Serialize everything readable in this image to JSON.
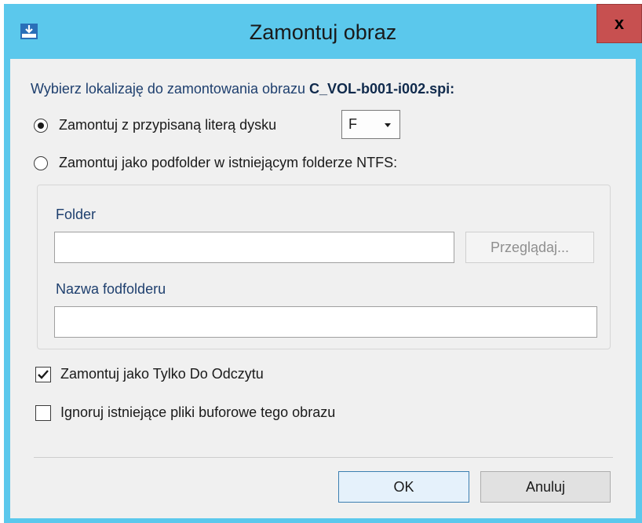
{
  "window": {
    "title": "Zamontuj obraz",
    "close_label": "x"
  },
  "dialog": {
    "prompt_text": "Wybierz lokalizaję do zamontowania obrazu ",
    "prompt_filename": "C_VOL-b001-i002.spi:",
    "option_drive_letter": {
      "label": "Zamontuj z przypisaną literą dysku",
      "selected": true,
      "drive_letter": "F"
    },
    "option_subfolder": {
      "label": "Zamontuj jako podfolder w istniejącym folderze NTFS:",
      "selected": false
    },
    "folder_label": "Folder",
    "folder_value": "",
    "browse_label": "Przeglądaj...",
    "subfolder_label": "Nazwa fodfolderu",
    "subfolder_value": "",
    "readonly_checkbox": {
      "label": "Zamontuj jako Tylko Do Odczytu",
      "checked": true
    },
    "ignore_checkbox": {
      "label": "Ignoruj istniejące pliki buforowe tego obrazu",
      "checked": false
    },
    "ok_label": "OK",
    "cancel_label": "Anuluj"
  },
  "colors": {
    "titlebar": "#5bc8ec",
    "close_button": "#c75050",
    "client_background": "#f0f0f0",
    "label_text": "#1e3f6e"
  }
}
